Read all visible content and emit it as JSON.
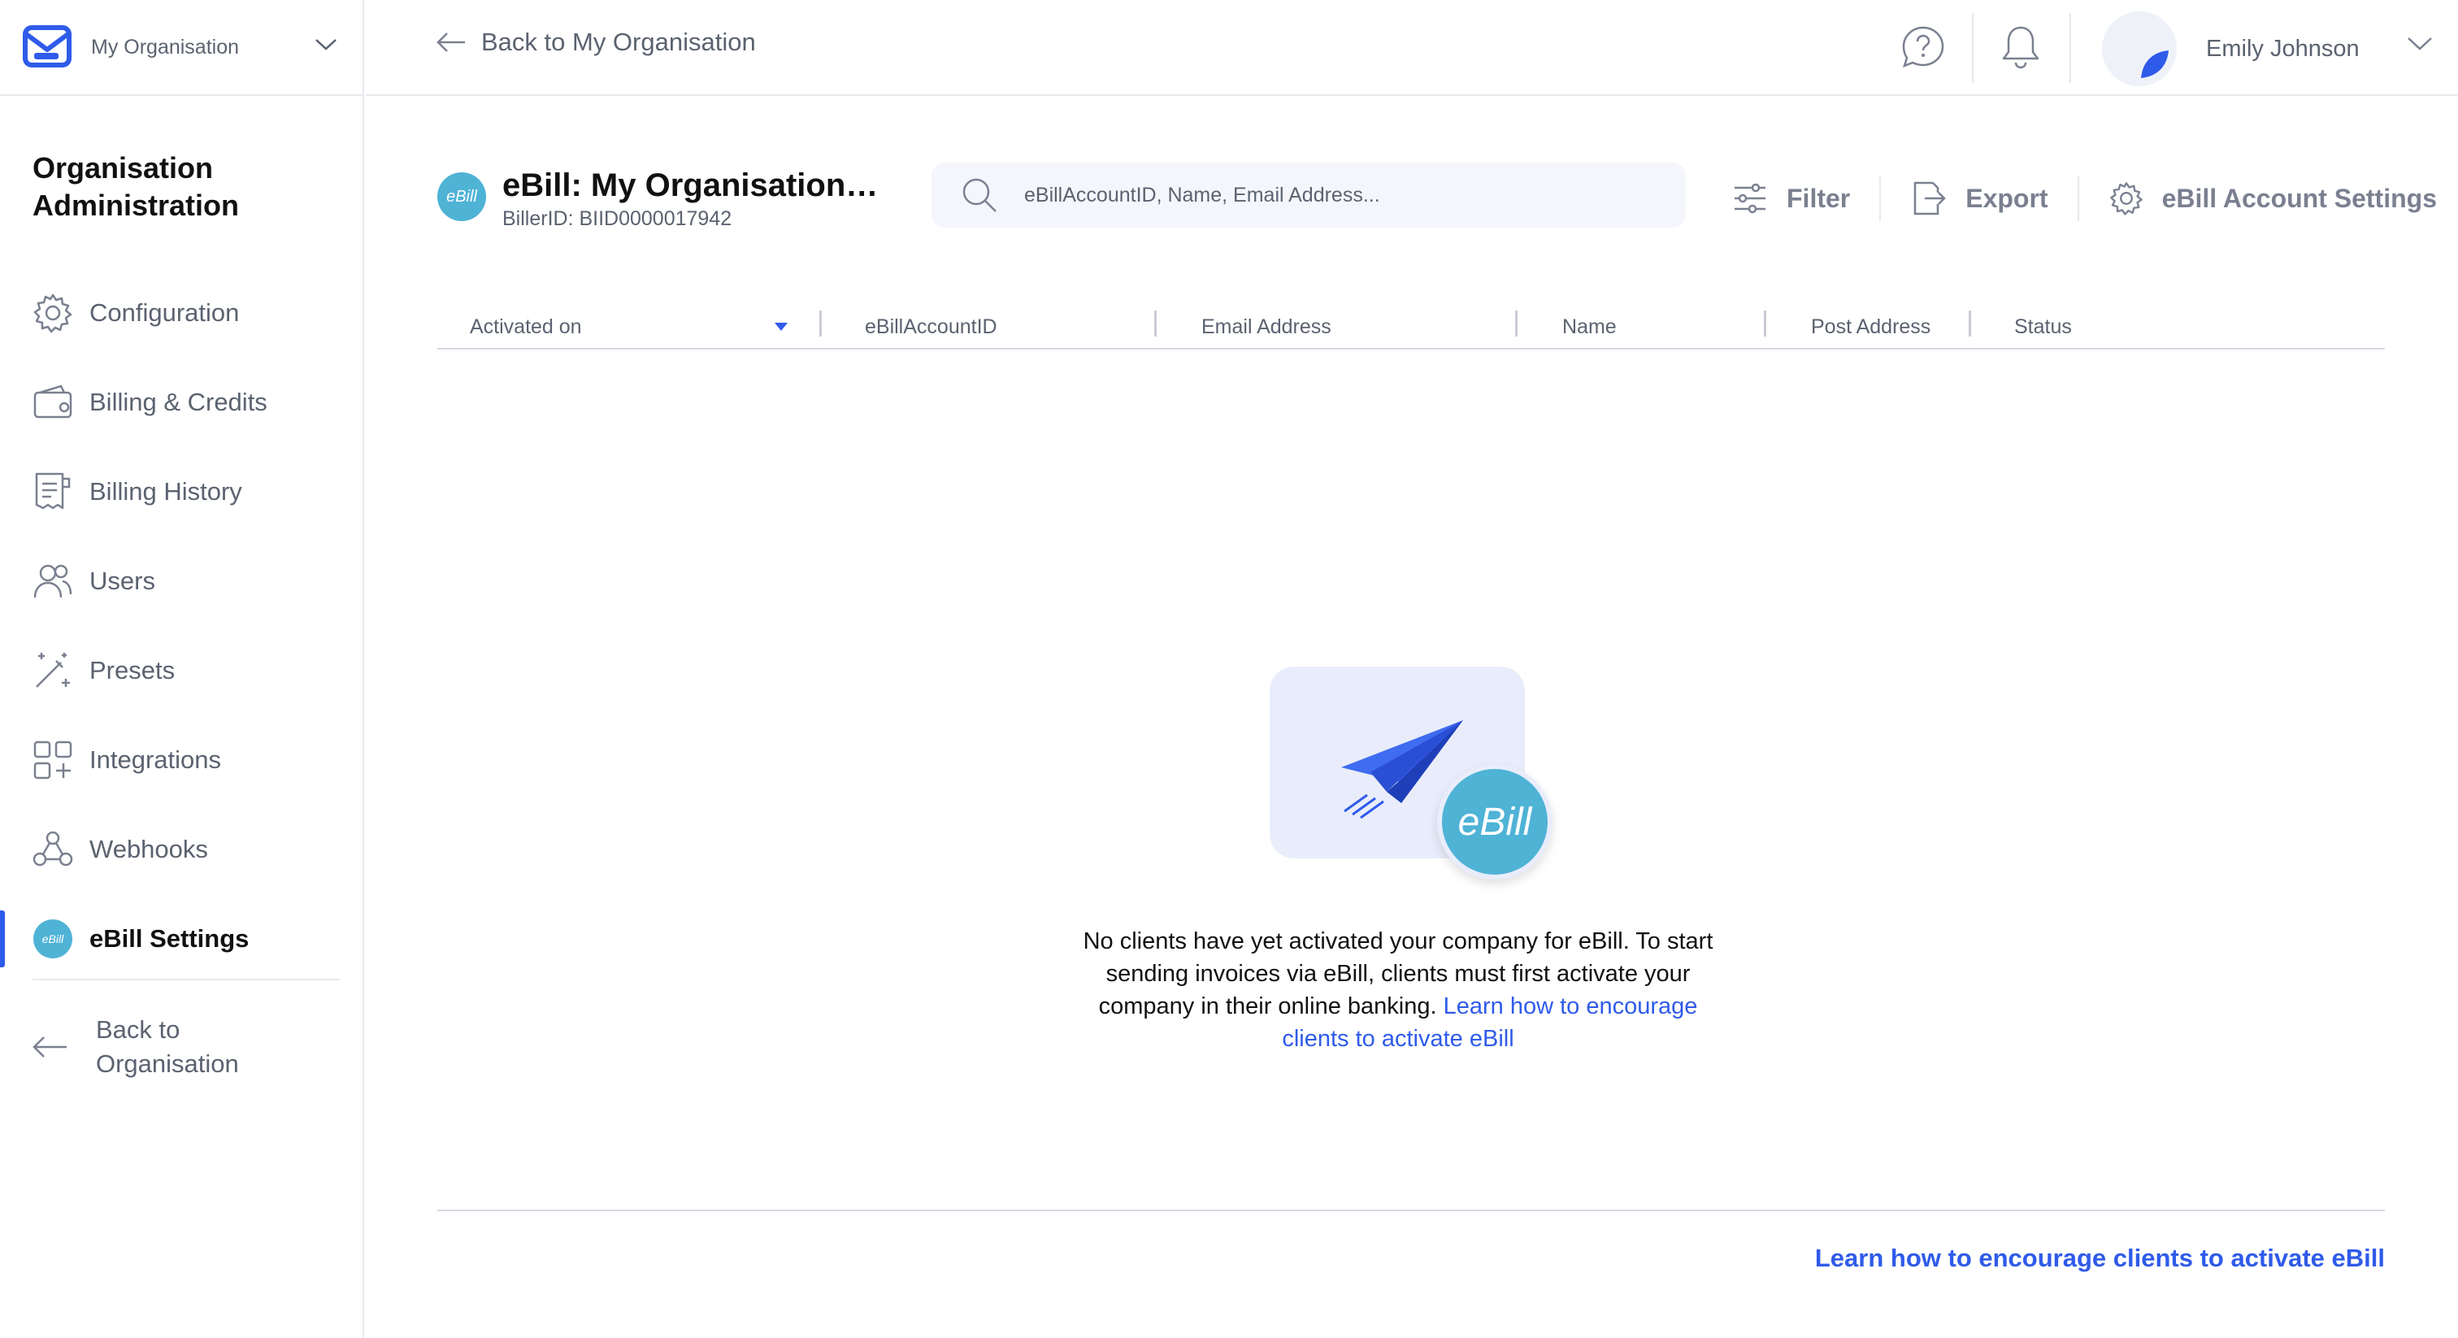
{
  "app": {
    "org_name": "My Organisation",
    "section_title": "Organisation Administration"
  },
  "sidebar": {
    "items": [
      {
        "label": "Configuration",
        "icon": "gear-icon"
      },
      {
        "label": "Billing & Credits",
        "icon": "wallet-icon"
      },
      {
        "label": "Billing History",
        "icon": "receipt-icon"
      },
      {
        "label": "Users",
        "icon": "users-icon"
      },
      {
        "label": "Presets",
        "icon": "magic-wand-icon"
      },
      {
        "label": "Integrations",
        "icon": "grid-plus-icon"
      },
      {
        "label": "Webhooks",
        "icon": "webhook-icon"
      },
      {
        "label": "eBill Settings",
        "icon": "ebill-icon",
        "active": true
      }
    ],
    "back_label": "Back to Organisation"
  },
  "header": {
    "back_label": "Back to My Organisation",
    "user_name": "Emily Johnson"
  },
  "biller": {
    "badge": "eBill",
    "name": "eBill: My Organisation G...",
    "id_label": "BillerID: BIID0000017942"
  },
  "search": {
    "placeholder": "eBillAccountID, Name, Email Address..."
  },
  "toolbar": {
    "filter": "Filter",
    "export": "Export",
    "settings": "eBill Account Settings"
  },
  "table": {
    "columns": [
      "Activated on",
      "eBillAccountID",
      "Email Address",
      "Name",
      "Post Address",
      "Status"
    ]
  },
  "empty_state": {
    "badge": "eBill",
    "message": "No clients have yet activated your company for eBill. To start sending invoices via eBill, clients must first activate your company in their online banking.",
    "link": "Learn how to encourage clients to activate eBill"
  },
  "footer": {
    "link": "Learn how to encourage clients to activate eBill"
  },
  "colors": {
    "accent": "#2f5bea",
    "ebill": "#4fb3d6",
    "muted_text": "#5b6270"
  }
}
